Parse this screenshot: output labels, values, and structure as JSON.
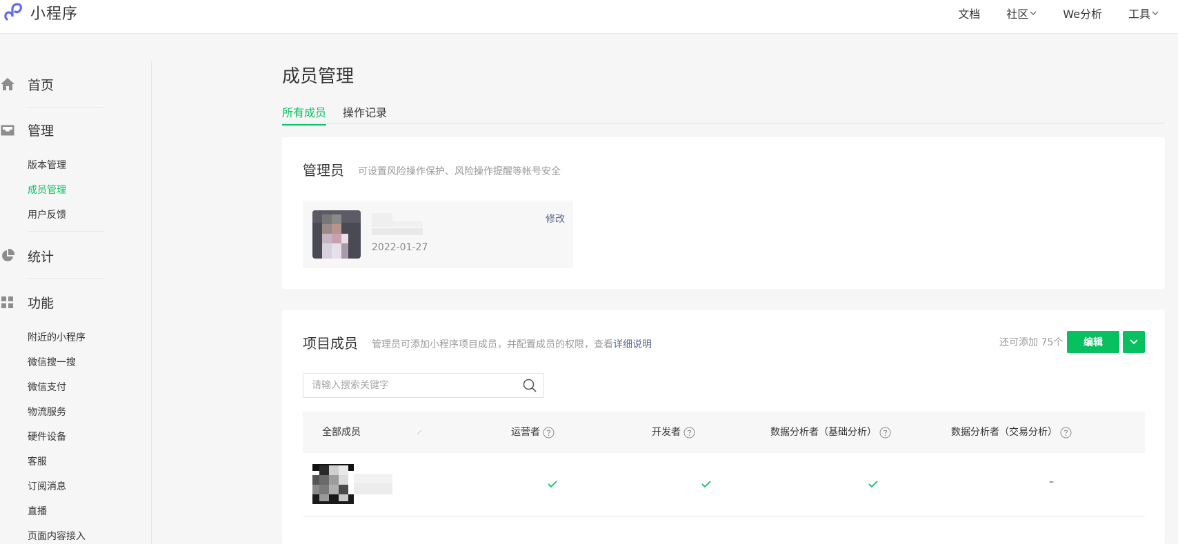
{
  "app": {
    "name": "小程序"
  },
  "topnav": [
    {
      "label": "文档",
      "has_dropdown": false
    },
    {
      "label": "社区",
      "has_dropdown": true
    },
    {
      "label": "We分析",
      "has_dropdown": false
    },
    {
      "label": "工具",
      "has_dropdown": true
    }
  ],
  "sidebar": {
    "home": "首页",
    "manage": "管理",
    "manage_items": [
      "版本管理",
      "成员管理",
      "用户反馈"
    ],
    "active_item": "成员管理",
    "stats": "统计",
    "features": "功能",
    "feature_items": [
      "附近的小程序",
      "微信搜一搜",
      "微信支付",
      "物流服务",
      "硬件设备",
      "客服",
      "订阅消息",
      "直播",
      "页面内容接入"
    ]
  },
  "page": {
    "title": "成员管理",
    "tabs": [
      "所有成员",
      "操作记录"
    ],
    "active_tab": "所有成员"
  },
  "admin_section": {
    "title": "管理员",
    "desc": "可设置风险操作保护、风险操作提醒等帐号安全",
    "admin_date": "2022-01-27",
    "edit_label": "修改"
  },
  "members_section": {
    "title": "项目成员",
    "desc_prefix": "管理员可添加小程序项目成员，并配置成员的权限，查看",
    "desc_link": "详细说明",
    "quota": "还可添加 75个",
    "edit_button": "编辑",
    "search_placeholder": "请输入搜索关键字",
    "columns": [
      "全部成员",
      "运营者",
      "开发者",
      "数据分析者（基础分析）",
      "数据分析者（交易分析）"
    ],
    "rows": [
      {
        "permissions": [
          "check",
          "check",
          "check",
          "–"
        ]
      }
    ]
  },
  "colors": {
    "accent": "#07c160",
    "link": "#576b95",
    "text": "#353535",
    "muted": "#9a9a9a"
  }
}
